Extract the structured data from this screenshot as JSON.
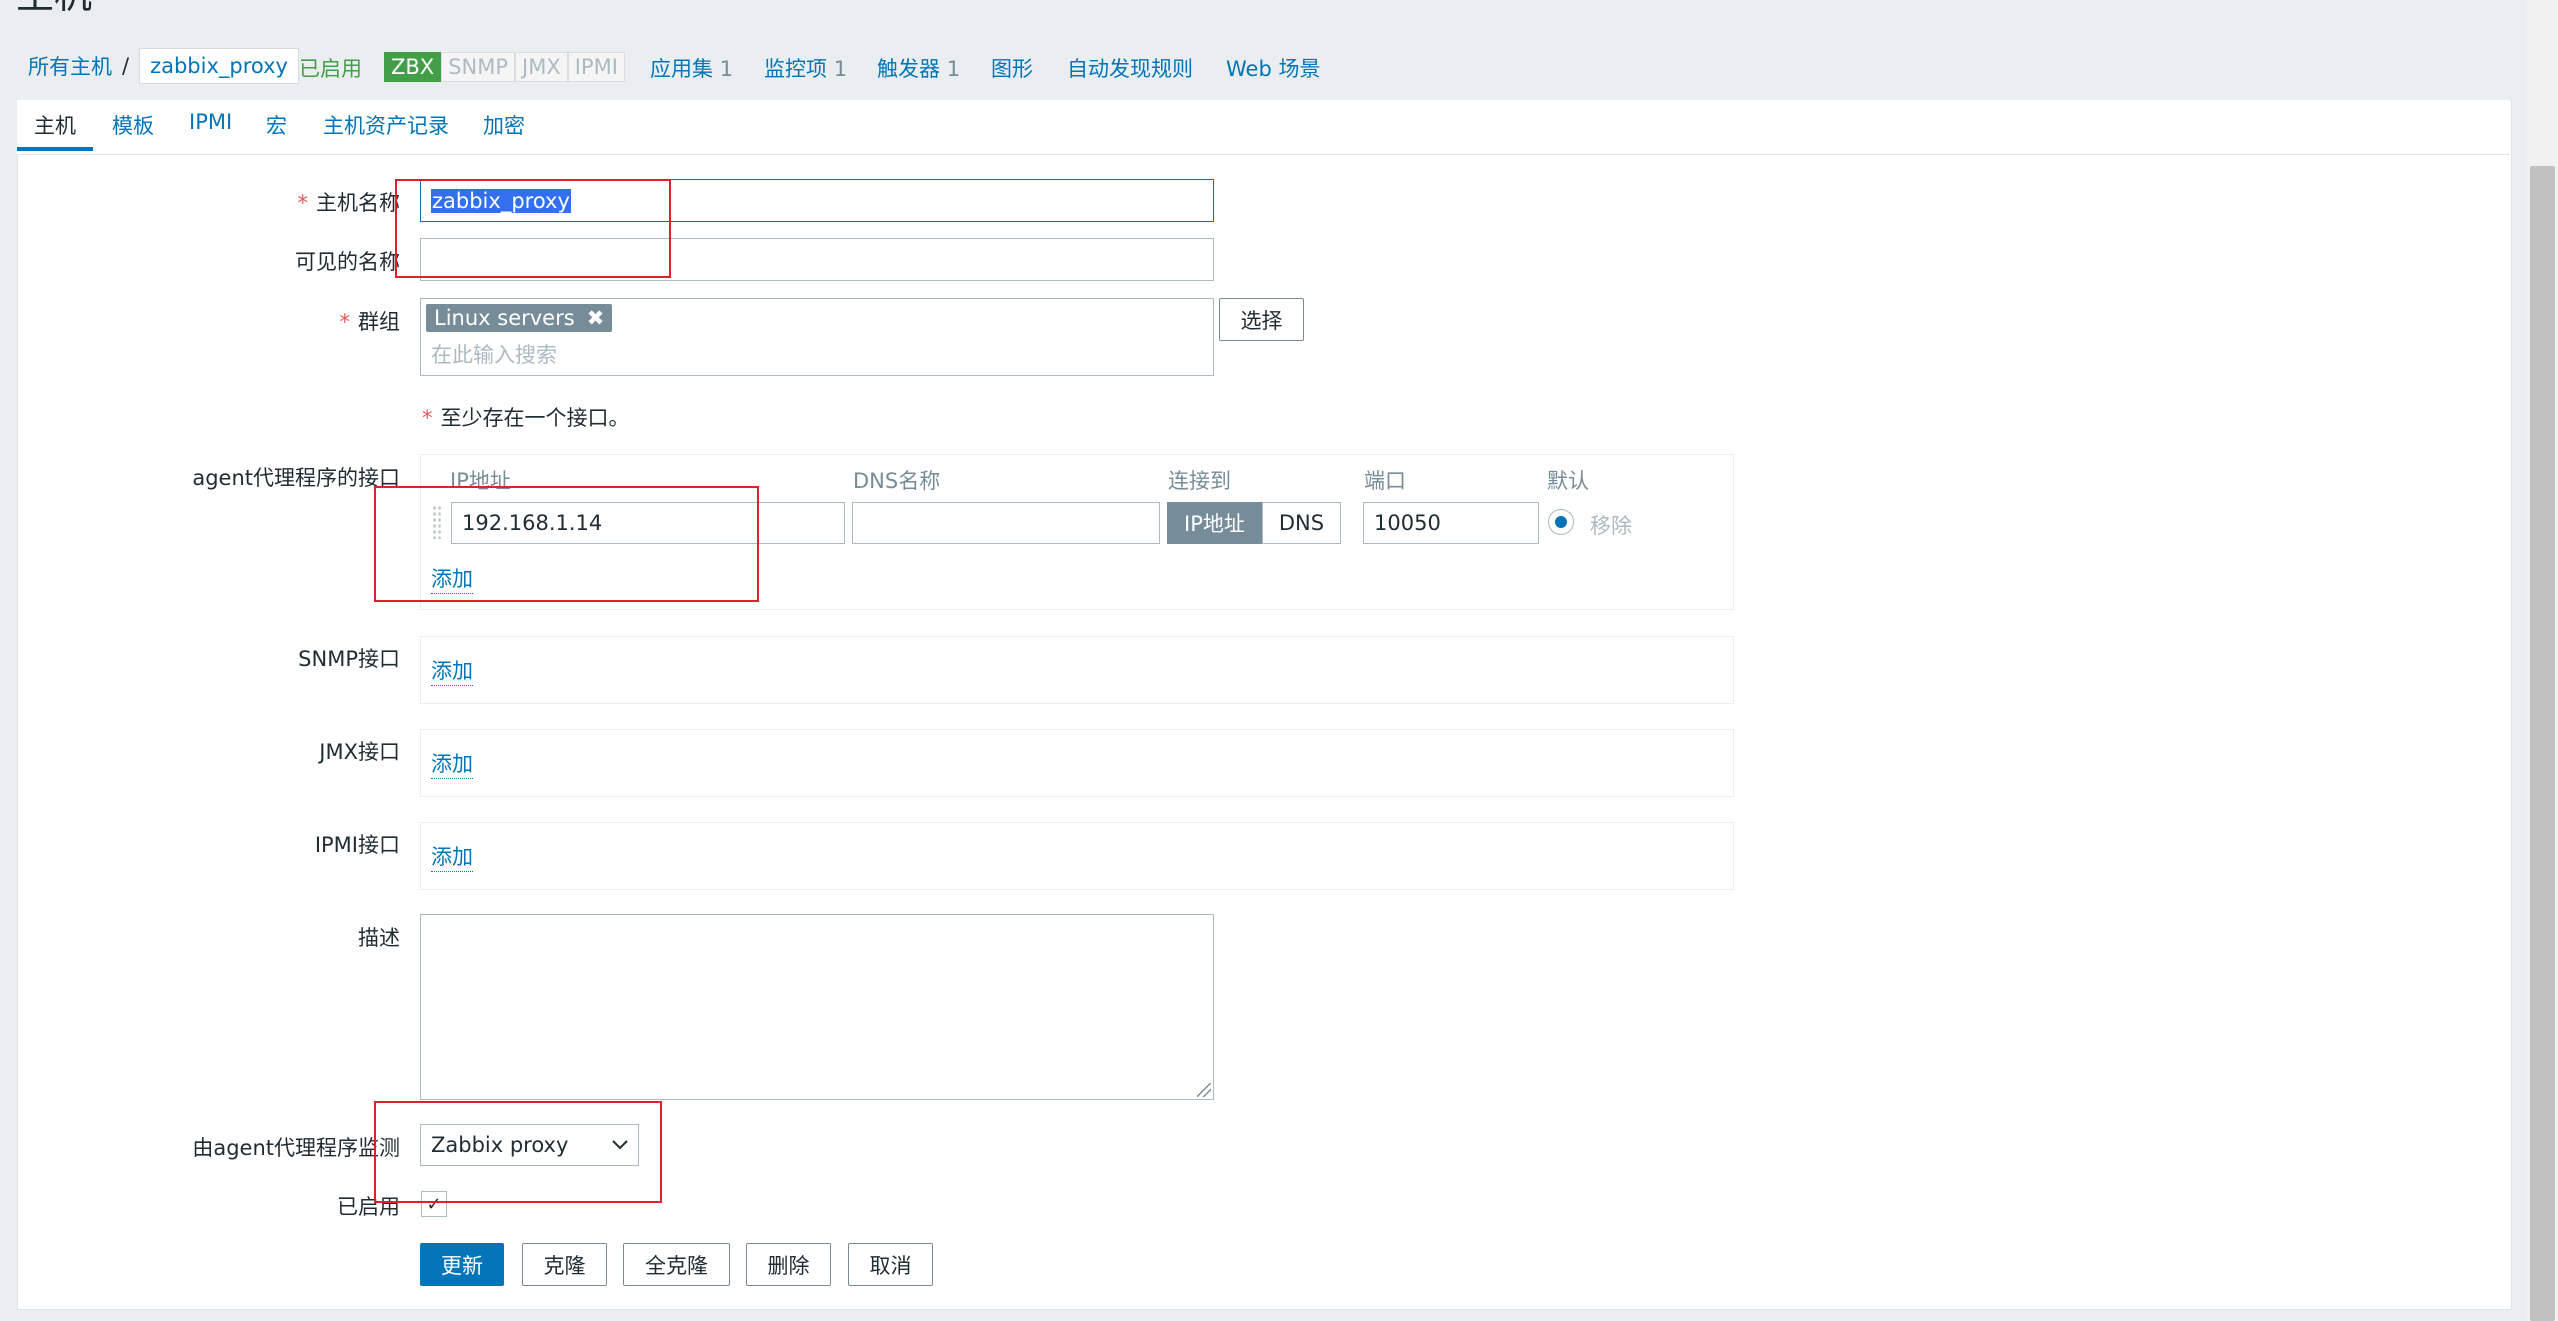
{
  "page": {
    "title": "主机"
  },
  "breadcrumb": {
    "all_hosts": "所有主机",
    "separator": "/",
    "current_host": "zabbix_proxy",
    "status": "已启用"
  },
  "availability": {
    "zbx": "ZBX",
    "snmp": "SNMP",
    "jmx": "JMX",
    "ipmi": "IPMI"
  },
  "host_links": [
    {
      "label": "应用集",
      "count": "1"
    },
    {
      "label": "监控项",
      "count": "1"
    },
    {
      "label": "触发器",
      "count": "1"
    },
    {
      "label": "图形",
      "count": ""
    },
    {
      "label": "自动发现规则",
      "count": ""
    },
    {
      "label": "Web 场景",
      "count": ""
    }
  ],
  "tabs": [
    "主机",
    "模板",
    "IPMI",
    "宏",
    "主机资产记录",
    "加密"
  ],
  "form": {
    "host_name": {
      "required": "*",
      "label": "主机名称",
      "value": "zabbix_proxy"
    },
    "visible_name": {
      "label": "可见的名称",
      "value": ""
    },
    "groups": {
      "required": "*",
      "label": "群组",
      "tag": "Linux servers",
      "tag_remove": "✖",
      "placeholder": "在此输入搜索",
      "select_button": "选择"
    },
    "interface_note": {
      "required": "*",
      "text": "至少存在一个接口。"
    },
    "agent_interfaces": {
      "label": "agent代理程序的接口",
      "headers": {
        "ip": "IP地址",
        "dns": "DNS名称",
        "connect": "连接到",
        "port": "端口",
        "default": "默认"
      },
      "ip": "192.168.1.14",
      "dns": "",
      "connect_ip": "IP地址",
      "connect_dns": "DNS",
      "port": "10050",
      "remove": "移除",
      "add": "添加"
    },
    "snmp": {
      "label": "SNMP接口",
      "add": "添加"
    },
    "jmx": {
      "label": "JMX接口",
      "add": "添加"
    },
    "ipmi": {
      "label": "IPMI接口",
      "add": "添加"
    },
    "description": {
      "label": "描述",
      "value": ""
    },
    "monitored_by": {
      "label": "由agent代理程序监测",
      "value": "Zabbix proxy"
    },
    "enabled": {
      "label": "已启用",
      "checked": true,
      "mark": "✓"
    }
  },
  "buttons": {
    "update": "更新",
    "clone": "克隆",
    "full_clone": "全克隆",
    "delete": "删除",
    "cancel": "取消"
  },
  "colors": {
    "accent": "#0275b8",
    "enabled_green": "#429e47",
    "required_red": "#e45959",
    "highlight_red": "#e0212b"
  }
}
